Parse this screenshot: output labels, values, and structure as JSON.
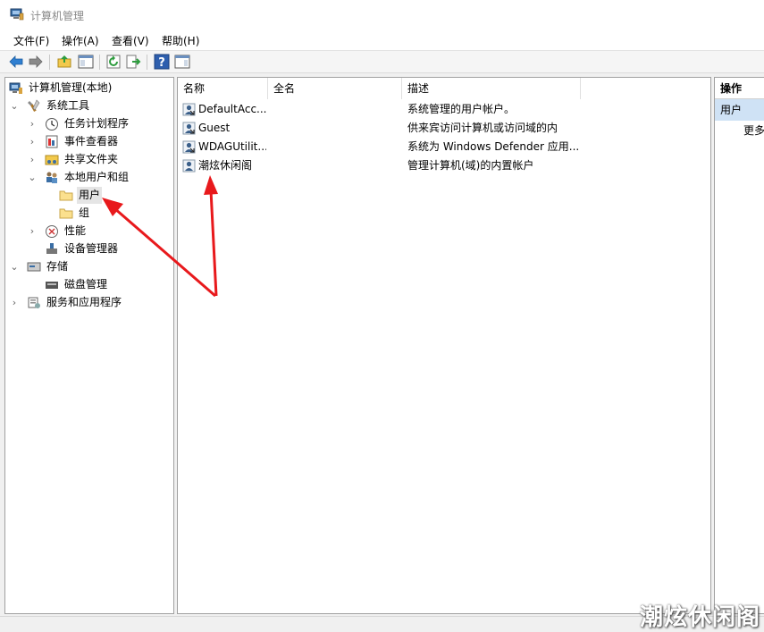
{
  "window": {
    "title": "计算机管理"
  },
  "menu": [
    "文件(F)",
    "操作(A)",
    "查看(V)",
    "帮助(H)"
  ],
  "tree": {
    "root": "计算机管理(本地)",
    "system_tools": "系统工具",
    "task_scheduler": "任务计划程序",
    "event_viewer": "事件查看器",
    "shared_folders": "共享文件夹",
    "local_users_groups": "本地用户和组",
    "users": "用户",
    "groups": "组",
    "performance": "性能",
    "device_manager": "设备管理器",
    "storage": "存储",
    "disk_management": "磁盘管理",
    "services_apps": "服务和应用程序"
  },
  "list": {
    "columns": [
      "名称",
      "全名",
      "描述"
    ],
    "rows": [
      {
        "name": "DefaultAcc...",
        "fullname": "",
        "desc": "系统管理的用户帐户。"
      },
      {
        "name": "Guest",
        "fullname": "",
        "desc": "供来宾访问计算机或访问域的内"
      },
      {
        "name": "WDAGUtilit...",
        "fullname": "",
        "desc": "系统为 Windows Defender 应用..."
      },
      {
        "name": "潮炫休闲阁",
        "fullname": "",
        "desc": "管理计算机(域)的内置帐户"
      }
    ]
  },
  "actions": {
    "title": "操作",
    "section": "用户",
    "more": "更多"
  },
  "watermark": "潮炫休闲阁",
  "colors": {
    "arrow": "#e8191c",
    "selection": "#cfe2f5"
  }
}
